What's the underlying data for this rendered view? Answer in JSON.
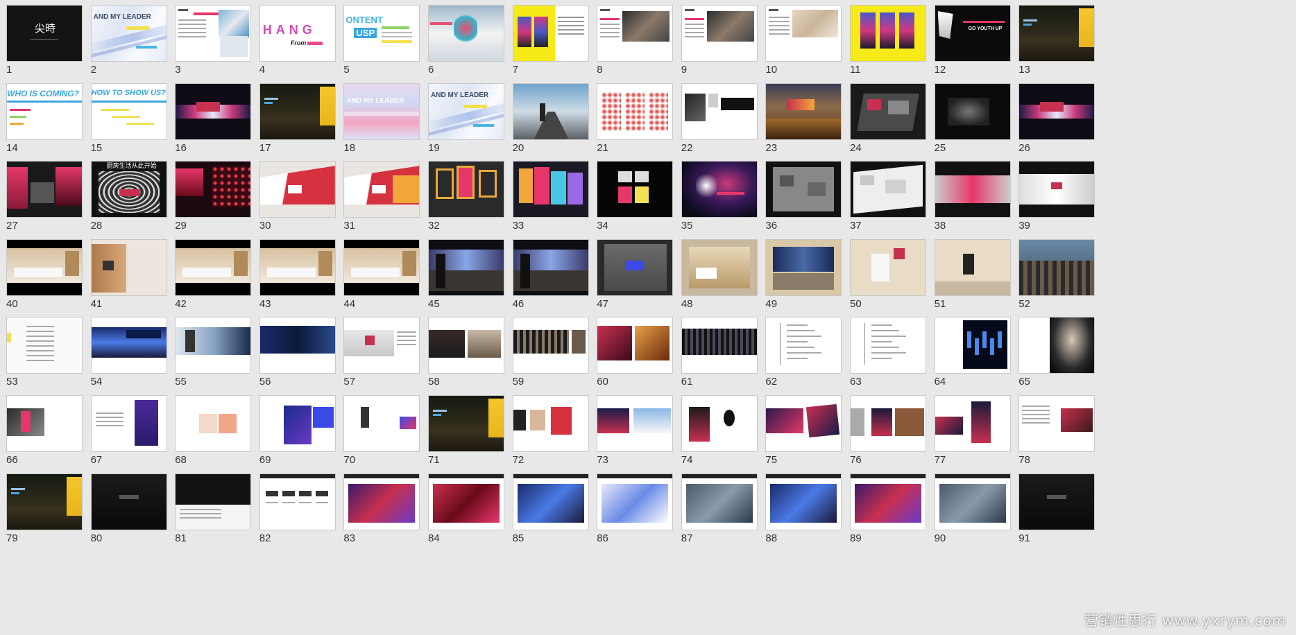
{
  "watermark": "营销性思行 www.yxrym.com",
  "text_labels": {
    "1": "尖時",
    "2": "AND MY LEADER",
    "4": "HANG",
    "4b": "From",
    "5": "ONTENT",
    "5b": "USP",
    "12": "GO YOUTH UP",
    "14": "WHO IS COMING?",
    "15": "HOW TO SHOW US?",
    "18": "AND MY LEADER",
    "19": "AND MY LEADER",
    "28": "厨房生活从此开始"
  },
  "slides": [
    {
      "n": "1",
      "style": "dark-title"
    },
    {
      "n": "2",
      "style": "leader-light"
    },
    {
      "n": "3",
      "style": "text-photo"
    },
    {
      "n": "4",
      "style": "change"
    },
    {
      "n": "5",
      "style": "content-usp"
    },
    {
      "n": "6",
      "style": "dancer"
    },
    {
      "n": "7",
      "style": "yellow-posters"
    },
    {
      "n": "8",
      "style": "text-photo-dark"
    },
    {
      "n": "9",
      "style": "text-photo-dark"
    },
    {
      "n": "10",
      "style": "text-photo-beige"
    },
    {
      "n": "11",
      "style": "yellow-triple"
    },
    {
      "n": "12",
      "style": "dark-youth"
    },
    {
      "n": "13",
      "style": "night-street"
    },
    {
      "n": "14",
      "style": "who"
    },
    {
      "n": "15",
      "style": "how"
    },
    {
      "n": "16",
      "style": "dark-stripe"
    },
    {
      "n": "17",
      "style": "night-street"
    },
    {
      "n": "18",
      "style": "leader-gradient"
    },
    {
      "n": "19",
      "style": "leader-light"
    },
    {
      "n": "20",
      "style": "road"
    },
    {
      "n": "21",
      "style": "red-dots"
    },
    {
      "n": "22",
      "style": "people-text"
    },
    {
      "n": "23",
      "style": "venue-sky"
    },
    {
      "n": "24",
      "style": "floorplan-dark"
    },
    {
      "n": "25",
      "style": "spot-dark"
    },
    {
      "n": "26",
      "style": "dark-stripe"
    },
    {
      "n": "27",
      "style": "red-booth"
    },
    {
      "n": "28",
      "style": "tunnel"
    },
    {
      "n": "29",
      "style": "red-grid"
    },
    {
      "n": "30",
      "style": "red-wave"
    },
    {
      "n": "31",
      "style": "red-wave"
    },
    {
      "n": "32",
      "style": "frames"
    },
    {
      "n": "33",
      "style": "color-boxes"
    },
    {
      "n": "34",
      "style": "dark-boxes"
    },
    {
      "n": "35",
      "style": "galaxy"
    },
    {
      "n": "36",
      "style": "floorplan-gray"
    },
    {
      "n": "37",
      "style": "floorplan-white"
    },
    {
      "n": "38",
      "style": "gallery-red"
    },
    {
      "n": "39",
      "style": "gallery-white"
    },
    {
      "n": "40",
      "style": "kitchen"
    },
    {
      "n": "41",
      "style": "kitchen-wood"
    },
    {
      "n": "42",
      "style": "kitchen"
    },
    {
      "n": "43",
      "style": "kitchen"
    },
    {
      "n": "44",
      "style": "kitchen"
    },
    {
      "n": "45",
      "style": "living-dark"
    },
    {
      "n": "46",
      "style": "living-dark"
    },
    {
      "n": "47",
      "style": "tv-room"
    },
    {
      "n": "48",
      "style": "bath"
    },
    {
      "n": "49",
      "style": "living-wide"
    },
    {
      "n": "50",
      "style": "wash"
    },
    {
      "n": "51",
      "style": "bath-light"
    },
    {
      "n": "52",
      "style": "crowd"
    },
    {
      "n": "53",
      "style": "list-white"
    },
    {
      "n": "54",
      "style": "stage-blue"
    },
    {
      "n": "55",
      "style": "speaker"
    },
    {
      "n": "56",
      "style": "stage-dark"
    },
    {
      "n": "57",
      "style": "room-photo"
    },
    {
      "n": "58",
      "style": "two-photos"
    },
    {
      "n": "59",
      "style": "group-photo"
    },
    {
      "n": "60",
      "style": "red-seats"
    },
    {
      "n": "61",
      "style": "crowd-dark"
    },
    {
      "n": "62",
      "style": "outline"
    },
    {
      "n": "63",
      "style": "outline"
    },
    {
      "n": "64",
      "style": "blue-dancers"
    },
    {
      "n": "65",
      "style": "spotlight"
    },
    {
      "n": "66",
      "style": "dancers-photo"
    },
    {
      "n": "67",
      "style": "purple-card"
    },
    {
      "n": "68",
      "style": "product-white"
    },
    {
      "n": "69",
      "style": "collage-blue"
    },
    {
      "n": "70",
      "style": "small-items"
    },
    {
      "n": "71",
      "style": "night-street"
    },
    {
      "n": "72",
      "style": "gifts"
    },
    {
      "n": "73",
      "style": "bus"
    },
    {
      "n": "74",
      "style": "standees"
    },
    {
      "n": "75",
      "style": "cards-red"
    },
    {
      "n": "76",
      "style": "photo-pair"
    },
    {
      "n": "77",
      "style": "cards-dark"
    },
    {
      "n": "78",
      "style": "text-red"
    },
    {
      "n": "79",
      "style": "night-street"
    },
    {
      "n": "80",
      "style": "dark-plain"
    },
    {
      "n": "81",
      "style": "dark-white"
    },
    {
      "n": "82",
      "style": "diagram"
    },
    {
      "n": "83",
      "style": "event-purple"
    },
    {
      "n": "84",
      "style": "event-red"
    },
    {
      "n": "85",
      "style": "event-blue"
    },
    {
      "n": "86",
      "style": "event-cofco"
    },
    {
      "n": "87",
      "style": "event-crowd"
    },
    {
      "n": "88",
      "style": "event-blue"
    },
    {
      "n": "89",
      "style": "event-purple"
    },
    {
      "n": "90",
      "style": "event-crowd"
    },
    {
      "n": "91",
      "style": "dark-plain"
    }
  ]
}
